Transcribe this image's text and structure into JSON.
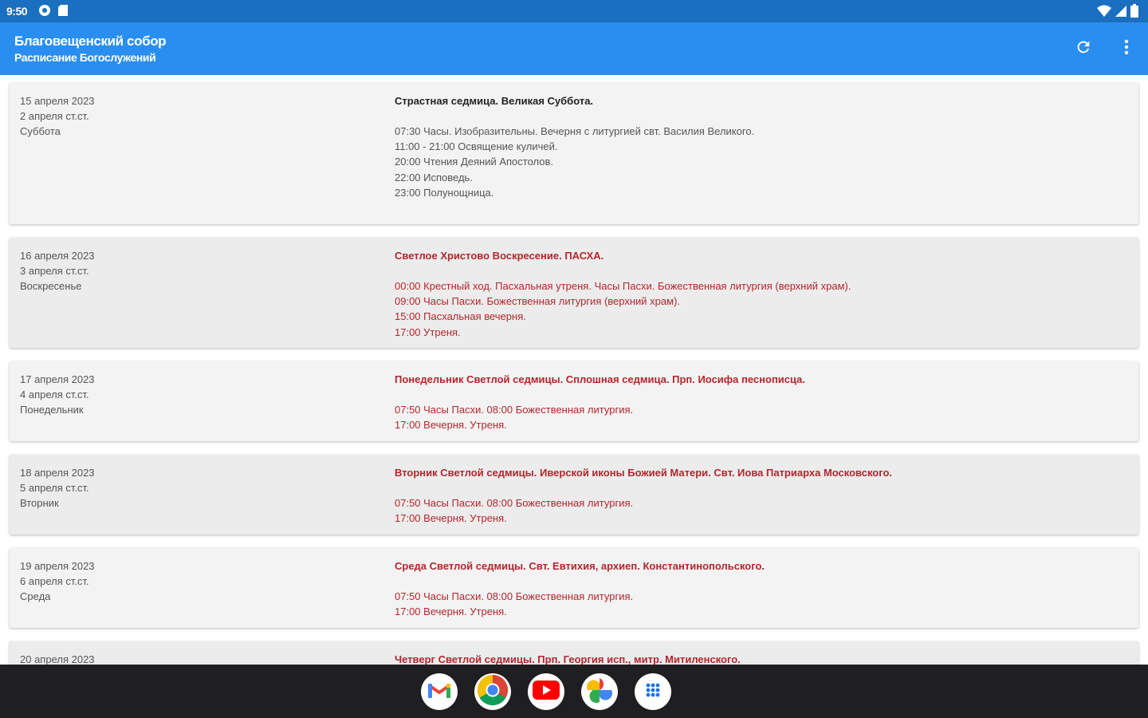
{
  "status_bar": {
    "time": "9:50",
    "left_icons": [
      "settings-status-icon",
      "sd-card-icon"
    ],
    "right_icons": [
      "wifi-icon",
      "signal-icon",
      "battery-icon"
    ]
  },
  "app_bar": {
    "title": "Благовещенский собор",
    "subtitle": "Расписание Богослужений",
    "actions": [
      "refresh-icon",
      "more-vert-icon"
    ]
  },
  "colors": {
    "app_bar": "#2a8ef0",
    "status_bar": "#1b6fc0",
    "feast_red": "#b3262d",
    "card_bg": "#f3f3f3",
    "card_bg_alt": "#ececec",
    "nav_bar": "#1f1f21"
  },
  "schedule": [
    {
      "date": "15 апреля 2023",
      "old_style": "2 апреля ст.ст.",
      "weekday": "Суббота",
      "title": "Страстная седмица. Великая Суббота.",
      "events": [
        "07:30 Часы. Изобразительны. Вечерня с литургией свт. Василия Великого.",
        "11:00 - 21:00 Освящение куличей.",
        "20:00 Чтения Деяний Апостолов.",
        "22:00 Исповедь.",
        "23:00 Полунощница."
      ],
      "feast": false
    },
    {
      "date": "16 апреля 2023",
      "old_style": "3 апреля ст.ст.",
      "weekday": "Воскресенье",
      "title": "Светлое Христово Воскресение. ПАСХА.",
      "events": [
        "00:00 Крестный ход. Пасхальная утреня. Часы Пасхи. Божественная литургия (верхний храм).",
        "09:00 Часы Пасхи. Божественная литургия (верхний храм).",
        "15:00 Пасхальная вечерня.",
        "17:00 Утреня."
      ],
      "feast": true
    },
    {
      "date": "17 апреля 2023",
      "old_style": "4 апреля ст.ст.",
      "weekday": "Понедельник",
      "title": "Понедельник Светлой седмицы. Сплошная седмица. Прп. Иосифа песнописца.",
      "events": [
        "07:50 Часы Пасхи. 08:00 Божественная литургия.",
        "17:00 Вечерня. Утреня."
      ],
      "feast": true
    },
    {
      "date": "18 апреля 2023",
      "old_style": "5 апреля ст.ст.",
      "weekday": "Вторник",
      "title": "Вторник Светлой седмицы. Иверской иконы Божией Матери. Свт. Иова Патриарха Московского.",
      "events": [
        "07:50 Часы Пасхи. 08:00 Божественная литургия.",
        "17:00 Вечерня. Утреня."
      ],
      "feast": true
    },
    {
      "date": "19 апреля 2023",
      "old_style": "6 апреля ст.ст.",
      "weekday": "Среда",
      "title": "Среда Светлой седмицы. Свт. Евтихия, архиеп. Константинопольского.",
      "events": [
        "07:50 Часы Пасхи. 08:00 Божественная литургия.",
        "17:00 Вечерня. Утреня."
      ],
      "feast": true
    },
    {
      "date": "20 апреля 2023",
      "old_style": "",
      "weekday": "",
      "title": "Четверг Светлой седмицы. Прп. Георгия исп., митр. Митиленского.",
      "events": [],
      "feast": true
    }
  ],
  "dock": {
    "apps": [
      {
        "name": "gmail-icon"
      },
      {
        "name": "chrome-icon"
      },
      {
        "name": "youtube-icon"
      },
      {
        "name": "photos-icon"
      },
      {
        "name": "app-drawer-icon"
      }
    ]
  }
}
